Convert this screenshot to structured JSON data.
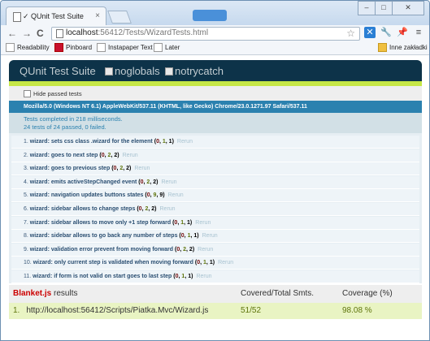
{
  "window": {
    "tab_title": "✓ QUnit Test Suite",
    "tab_close": "×",
    "controls": {
      "minimize": "‒",
      "maximize": "□",
      "close": "✕"
    }
  },
  "toolbar": {
    "back": "←",
    "forward": "→",
    "reload": "C",
    "url_host": "localhost",
    "url_rest": ":56412/Tests/WizardTests.html",
    "icons": [
      "star-icon",
      "bluesky-icon",
      "wrench-icon",
      "pin-icon",
      "menu-icon"
    ]
  },
  "bookmarks": [
    {
      "label": "Readability",
      "icon": "page-icon"
    },
    {
      "label": "Pinboard",
      "icon": "pinboard-icon"
    },
    {
      "label": "Instapaper Text",
      "icon": "page-icon"
    },
    {
      "label": "Later",
      "icon": "page-icon"
    }
  ],
  "bookmarks_other": "Inne zakładki",
  "qunit": {
    "header_title": "QUnit Test Suite",
    "options": [
      "noglobals",
      "notrycatch"
    ],
    "hide_passed": "Hide passed tests",
    "user_agent": "Mozilla/5.0 (Windows NT 6.1) AppleWebKit/537.11 (KHTML, like Gecko) Chrome/23.0.1271.97 Safari/537.11",
    "result_line1": "Tests completed in 218 milliseconds.",
    "result_line2": "24 tests of 24 passed, 0 failed.",
    "rerun_label": "Rerun",
    "tests": [
      {
        "num": "1.",
        "module": "wizard:",
        "name": "sets css class .wizard for the element",
        "failed": "0",
        "passed": "1",
        "total": "1"
      },
      {
        "num": "2.",
        "module": "wizard:",
        "name": "goes to next step",
        "failed": "0",
        "passed": "2",
        "total": "2"
      },
      {
        "num": "3.",
        "module": "wizard:",
        "name": "goes to previous step",
        "failed": "0",
        "passed": "2",
        "total": "2"
      },
      {
        "num": "4.",
        "module": "wizard:",
        "name": "emits activeStepChanged event",
        "failed": "0",
        "passed": "2",
        "total": "2"
      },
      {
        "num": "5.",
        "module": "wizard:",
        "name": "navigation updates buttons states",
        "failed": "0",
        "passed": "9",
        "total": "9"
      },
      {
        "num": "6.",
        "module": "wizard:",
        "name": "sidebar allows to change steps",
        "failed": "0",
        "passed": "2",
        "total": "2"
      },
      {
        "num": "7.",
        "module": "wizard:",
        "name": "sidebar allows to move only +1 step forward",
        "failed": "0",
        "passed": "1",
        "total": "1"
      },
      {
        "num": "8.",
        "module": "wizard:",
        "name": "sidebar allows to go back any number of steps",
        "failed": "0",
        "passed": "1",
        "total": "1"
      },
      {
        "num": "9.",
        "module": "wizard:",
        "name": "validation error prevent from moving forward",
        "failed": "0",
        "passed": "2",
        "total": "2"
      },
      {
        "num": "10.",
        "module": "wizard:",
        "name": "only current step is validated when moving forward",
        "failed": "0",
        "passed": "1",
        "total": "1"
      },
      {
        "num": "11.",
        "module": "wizard:",
        "name": "if form is not valid on start goes to last step",
        "failed": "0",
        "passed": "1",
        "total": "1"
      }
    ]
  },
  "blanket": {
    "brand": "Blanket.js",
    "results_label": " results",
    "col_covered": "Covered/Total Smts.",
    "col_coverage": "Coverage (%)",
    "rows": [
      {
        "num": "1.",
        "file": "http://localhost:56412/Scripts/Piatka.Mvc/Wizard.js",
        "covered": "51/52",
        "coverage": "98.08 %"
      }
    ]
  }
}
